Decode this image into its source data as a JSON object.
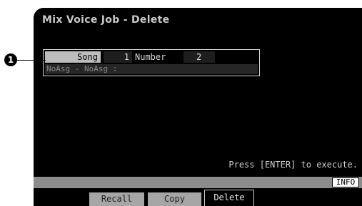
{
  "screen": {
    "title": "Mix Voice Job - Delete",
    "hint": "Press [ENTER] to execute."
  },
  "params": {
    "song_label": "Song",
    "song_value": "1",
    "number_label": "Number",
    "number_value": "2",
    "voice_name": "NoAsg - NoAsg :"
  },
  "status_bar": {
    "info_label": "INFO"
  },
  "tabs": [
    {
      "label": "Recall",
      "active": false
    },
    {
      "label": "Copy",
      "active": false
    },
    {
      "label": "Delete",
      "active": true
    }
  ],
  "callout": {
    "number": "1"
  },
  "colors": {
    "screen_bg": "#000000",
    "song_label_bg": "#bdbdbd",
    "status_bar_bg": "#8c8c8c",
    "tab_inactive_bg": "#a6a6a6"
  }
}
